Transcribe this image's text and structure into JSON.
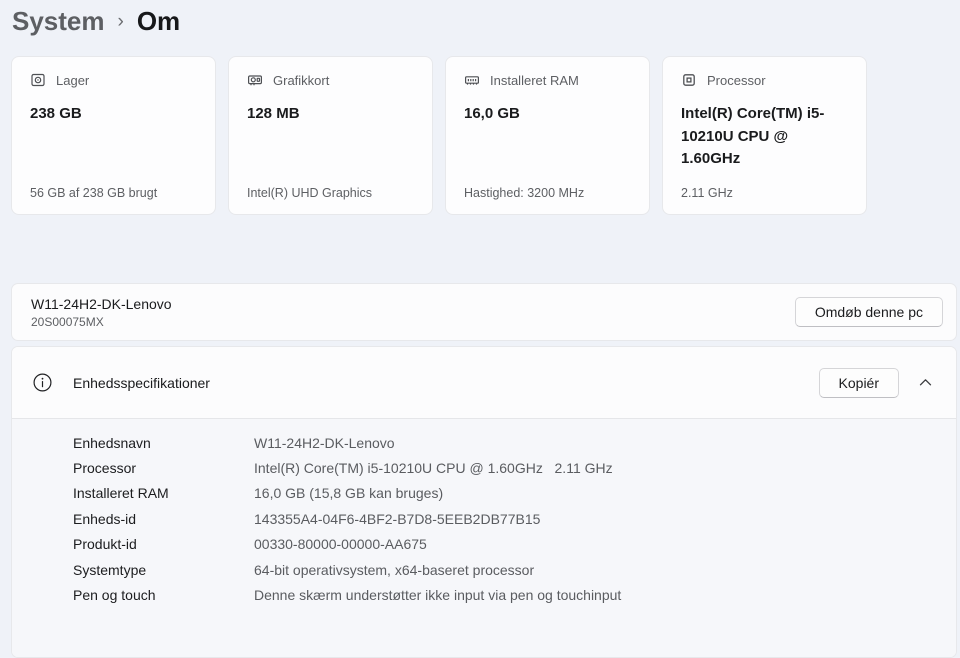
{
  "breadcrumb": {
    "parent": "System",
    "separator": "›",
    "current": "Om"
  },
  "cards": [
    {
      "icon": "storage-icon",
      "title": "Lager",
      "value": "238 GB",
      "caption": "56 GB af 238 GB brugt"
    },
    {
      "icon": "gpu-icon",
      "title": "Grafikkort",
      "value": "128 MB",
      "caption": "Intel(R) UHD Graphics"
    },
    {
      "icon": "ram-icon",
      "title": "Installeret RAM",
      "value": "16,0 GB",
      "caption": "Hastighed: 3200 MHz"
    },
    {
      "icon": "processor-icon",
      "title": "Processor",
      "value": "Intel(R) Core(TM) i5-10210U CPU @ 1.60GHz",
      "caption": "2.11 GHz"
    }
  ],
  "device_panel": {
    "name": "W11-24H2-DK-Lenovo",
    "model": "20S00075MX",
    "rename_button": "Omdøb denne pc"
  },
  "specs_panel": {
    "title": "Enhedsspecifikationer",
    "copy_button": "Kopiér",
    "rows": [
      {
        "label": "Enhedsnavn",
        "value": "W11-24H2-DK-Lenovo"
      },
      {
        "label": "Processor",
        "value": "Intel(R) Core(TM) i5-10210U CPU @ 1.60GHz   2.11 GHz"
      },
      {
        "label": "Installeret RAM",
        "value": "16,0 GB (15,8 GB kan bruges)"
      },
      {
        "label": "Enheds-id",
        "value": "143355A4-04F6-4BF2-B7D8-5EEB2DB77B15"
      },
      {
        "label": "Produkt-id",
        "value": "00330-80000-00000-AA675"
      },
      {
        "label": "Systemtype",
        "value": "64-bit operativsystem, x64-baseret processor"
      },
      {
        "label": "Pen og touch",
        "value": "Denne skærm understøtter ikke input via pen og touchinput"
      }
    ]
  },
  "colors": {
    "page_background": "#eff2f8",
    "card_background": "#fdfdfe",
    "panel_background": "#fcfcfd",
    "expander_body_background": "#f6f7fa",
    "border": "#e7e8eb",
    "text_primary": "#1a1b1d",
    "text_secondary": "#5d5f63"
  }
}
